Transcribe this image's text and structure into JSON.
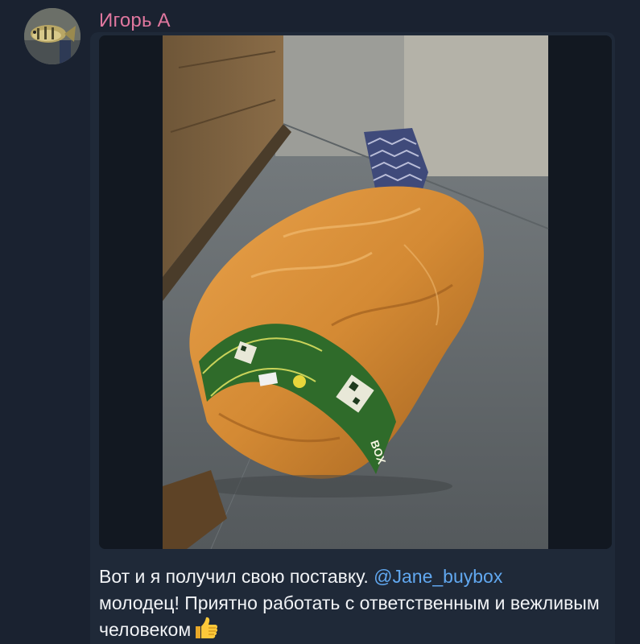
{
  "message": {
    "sender_name": "Игорь А",
    "text_before_mention": "Вот и я получил свою поставку. ",
    "mention": "@Jane_buybox",
    "text_after_mention": "молодец! Приятно работать с ответственным и вежливым человеком",
    "emoji": "thumbs-up"
  },
  "photo": {
    "tape_brand": "BOX"
  },
  "colors": {
    "background": "#1a2230",
    "sender_name": "#e0779f",
    "mention_link": "#61a8f0",
    "message_text": "#f1f3f6"
  }
}
